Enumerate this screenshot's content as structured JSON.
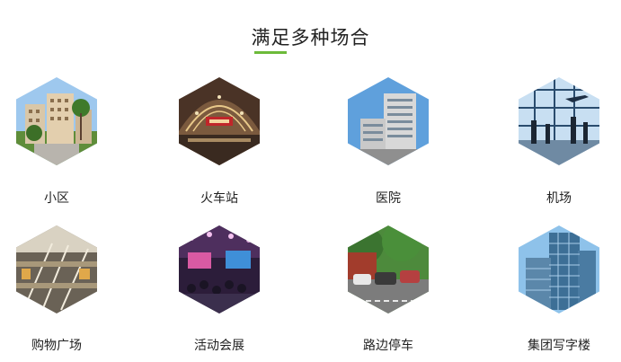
{
  "section": {
    "title": "满足多种场合",
    "accent_color": "#6cba3a"
  },
  "scenes": [
    {
      "label": "小区",
      "icon": "residential-community-photo"
    },
    {
      "label": "火车站",
      "icon": "train-station-photo"
    },
    {
      "label": "医院",
      "icon": "hospital-photo"
    },
    {
      "label": "机场",
      "icon": "airport-photo"
    },
    {
      "label": "购物广场",
      "icon": "shopping-mall-photo"
    },
    {
      "label": "活动会展",
      "icon": "exhibition-event-photo"
    },
    {
      "label": "路边停车",
      "icon": "roadside-parking-photo"
    },
    {
      "label": "集团写字楼",
      "icon": "office-tower-photo"
    }
  ]
}
